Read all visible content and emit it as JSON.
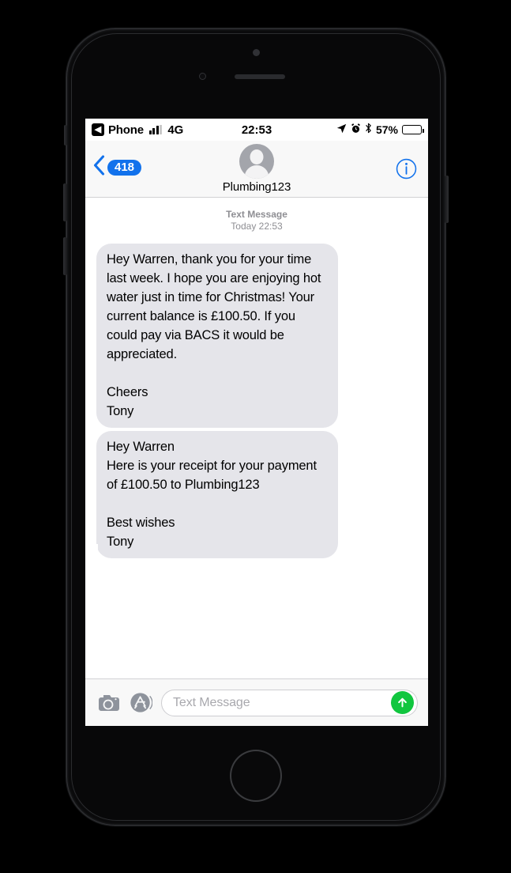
{
  "device": {
    "name": "iphone-frame",
    "home_button": "home-button"
  },
  "status_bar": {
    "back_app_glyph": "◀",
    "carrier_return_label": "Phone",
    "signal_bars_filled": 3,
    "signal_bars_total": 4,
    "network": "4G",
    "time": "22:53",
    "battery_percent_label": "57%",
    "battery_level": 57,
    "icons": [
      "location-arrow-icon",
      "alarm-clock-icon",
      "bluetooth-icon"
    ]
  },
  "nav_bar": {
    "back_badge": "418",
    "contact_name": "Plumbing123",
    "info_label": "i",
    "accent_color": "#1272ec"
  },
  "conversation": {
    "divider": {
      "kind": "Text Message",
      "timestamp": "Today 22:53"
    },
    "messages": [
      {
        "id": "message-1",
        "side": "incoming",
        "tail": false,
        "text": "Hey Warren, thank you for your time last week. I hope you are enjoying hot water just in time for Christmas! Your current balance is £100.50. If you could pay via BACS it would be appreciated.\n\nCheers\nTony"
      },
      {
        "id": "message-2",
        "side": "incoming",
        "tail": true,
        "text": "Hey Warren\nHere is your receipt for your payment of £100.50 to Plumbing123\n\nBest wishes\nTony"
      }
    ],
    "bubble_color": "#e5e5ea"
  },
  "input_bar": {
    "camera_label": "camera-icon",
    "appstore_label": "app-store-icon",
    "placeholder": "Text Message",
    "value": "",
    "send_color": "#11c63f"
  }
}
